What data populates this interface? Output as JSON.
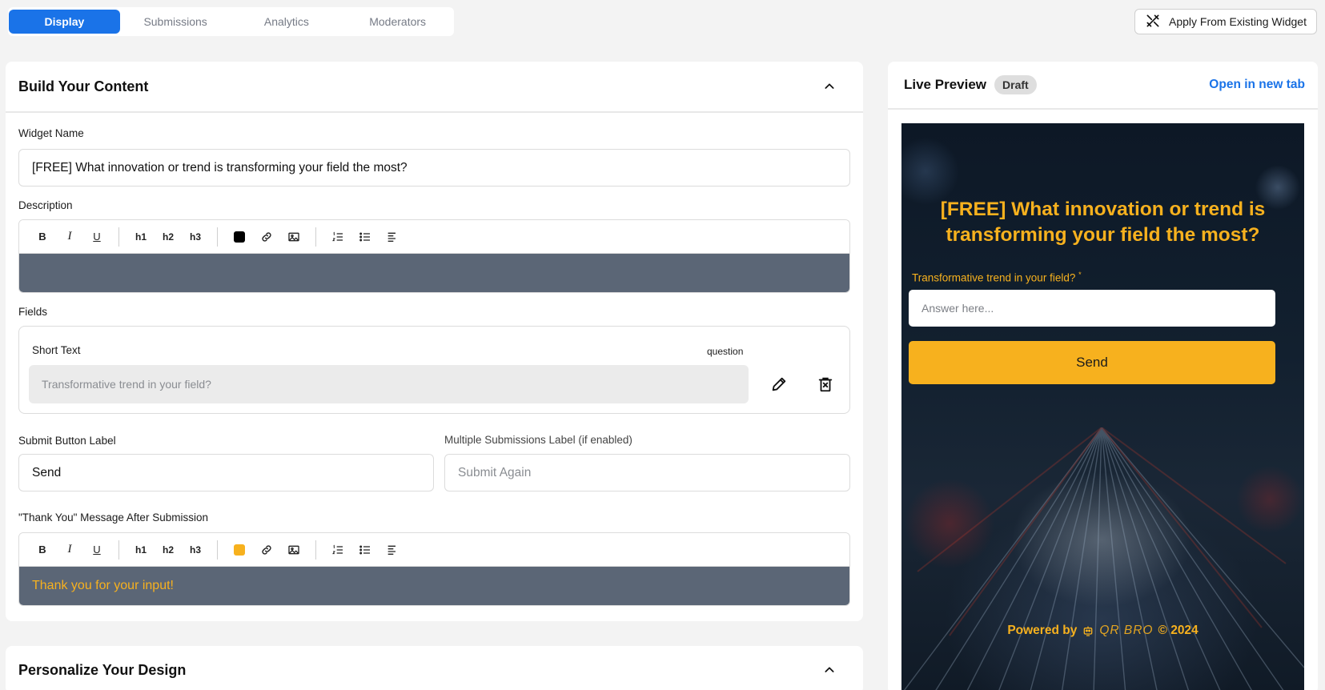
{
  "tabs": [
    {
      "label": "Display",
      "active": true
    },
    {
      "label": "Submissions",
      "active": false
    },
    {
      "label": "Analytics",
      "active": false
    },
    {
      "label": "Moderators",
      "active": false
    }
  ],
  "apply_button": {
    "label": "Apply From Existing Widget",
    "icon": "tools-icon"
  },
  "build": {
    "title": "Build Your Content",
    "widget_name_label": "Widget Name",
    "widget_name_value": "[FREE] What innovation or trend is transforming your field the most?",
    "description_label": "Description",
    "fields_label": "Fields",
    "field": {
      "type": "Short Text",
      "tag": "question",
      "value": "Transformative trend in your field?"
    },
    "submit_label_label": "Submit Button Label",
    "submit_label_value": "Send",
    "multi_label_label": "Multiple Submissions Label (if enabled)",
    "multi_label_placeholder": "Submit Again",
    "thankyou_label": "\"Thank You\" Message After Submission",
    "thankyou_value": "Thank you for your input!"
  },
  "toolbar": {
    "bold": "B",
    "italic": "I",
    "underline": "U",
    "h1": "h1",
    "h2": "h2",
    "h3": "h3"
  },
  "colors": {
    "accent": "#1a73e8",
    "brand_yellow": "#f7b11e",
    "editor_bg": "#5b6676",
    "desc_swatch": "#000000",
    "thanks_swatch": "#f7b11e"
  },
  "personalize": {
    "title": "Personalize Your Design"
  },
  "preview": {
    "title": "Live Preview",
    "badge": "Draft",
    "open_link": "Open in new tab",
    "widget_title": "[FREE] What innovation or trend is transforming your field the most?",
    "field_label": "Transformative trend in your field?",
    "required_mark": "*",
    "input_placeholder": "Answer here...",
    "send_label": "Send",
    "footer_prefix": "Powered by",
    "footer_logo": "QR BRO",
    "footer_suffix": "© 2024"
  }
}
